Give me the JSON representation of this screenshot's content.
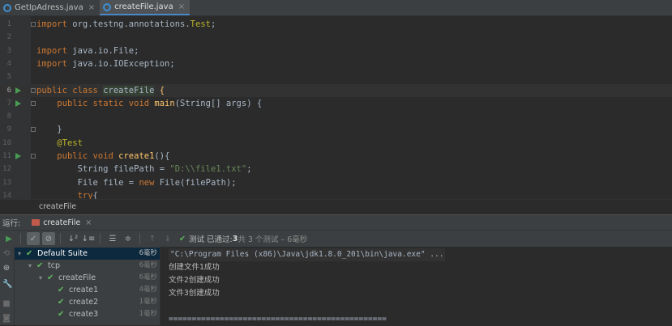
{
  "tabs": [
    {
      "label": "GetIpAdress.java",
      "active": false
    },
    {
      "label": "createFile.java",
      "active": true
    }
  ],
  "editor": {
    "lines": [
      {
        "no": "1",
        "tokens": [
          [
            "kw",
            "import "
          ],
          [
            "plain",
            "org.testng.annotations."
          ],
          [
            "ann",
            "Test"
          ],
          [
            "plain",
            ";"
          ]
        ]
      },
      {
        "no": "2",
        "tokens": []
      },
      {
        "no": "3",
        "tokens": [
          [
            "kw",
            "import "
          ],
          [
            "plain",
            "java.io.File;"
          ]
        ]
      },
      {
        "no": "4",
        "tokens": [
          [
            "kw",
            "import "
          ],
          [
            "plain",
            "java.io.IOException;"
          ]
        ]
      },
      {
        "no": "5",
        "tokens": []
      },
      {
        "no": "6",
        "tokens": [
          [
            "kw",
            "public class "
          ],
          [
            "hl",
            "createFile"
          ],
          [
            "plain",
            " "
          ],
          [
            "fn",
            "{"
          ]
        ]
      },
      {
        "no": "7",
        "tokens": [
          [
            "plain",
            "    "
          ],
          [
            "kw",
            "public static void "
          ],
          [
            "fn",
            "main"
          ],
          [
            "plain",
            "(String[] args) {"
          ]
        ]
      },
      {
        "no": "8",
        "tokens": []
      },
      {
        "no": "9",
        "tokens": [
          [
            "plain",
            "    }"
          ]
        ]
      },
      {
        "no": "10",
        "tokens": [
          [
            "plain",
            "    "
          ],
          [
            "ann",
            "@Test"
          ]
        ]
      },
      {
        "no": "11",
        "tokens": [
          [
            "plain",
            "    "
          ],
          [
            "kw",
            "public void "
          ],
          [
            "fn",
            "create1"
          ],
          [
            "plain",
            "(){"
          ]
        ]
      },
      {
        "no": "12",
        "tokens": [
          [
            "plain",
            "        String filePath = "
          ],
          [
            "str",
            "\"D:\\\\file1.txt\""
          ],
          [
            "plain",
            ";"
          ]
        ]
      },
      {
        "no": "13",
        "tokens": [
          [
            "plain",
            "        File file = "
          ],
          [
            "kw",
            "new "
          ],
          [
            "plain",
            "File(filePath);"
          ]
        ]
      },
      {
        "no": "14",
        "tokens": [
          [
            "plain",
            "        "
          ],
          [
            "kw",
            "try"
          ],
          [
            "plain",
            "{"
          ]
        ]
      }
    ]
  },
  "breadcrumb": "createFile",
  "run_window": {
    "label": "运行:",
    "tab": "createFile"
  },
  "run_status": {
    "prefix": "测试 已通过: ",
    "passed": "3",
    "suffix": "共 3 个测试 – 6毫秒"
  },
  "tree": [
    {
      "name": "Default Suite",
      "time": "6毫秒",
      "depth": 0,
      "selected": true
    },
    {
      "name": "tcp",
      "time": "6毫秒",
      "depth": 1,
      "selected": false
    },
    {
      "name": "createFile",
      "time": "6毫秒",
      "depth": 2,
      "selected": false
    },
    {
      "name": "create1",
      "time": "4毫秒",
      "depth": 3,
      "selected": false
    },
    {
      "name": "create2",
      "time": "1毫秒",
      "depth": 3,
      "selected": false
    },
    {
      "name": "create3",
      "time": "1毫秒",
      "depth": 3,
      "selected": false
    }
  ],
  "console": [
    "\"C:\\Program Files (x86)\\Java\\jdk1.8.0_201\\bin\\java.exe\" ...",
    "创建文件1成功",
    "文件2创建成功",
    "文件3创建成功",
    "",
    "==============================================="
  ],
  "colors": {
    "pass": "#5fb85f",
    "run_icon": "#499c54",
    "selection": "#0d293e",
    "keyword": "#cc7832",
    "string": "#6a8759",
    "annotation": "#bbb529",
    "function": "#ffc66d"
  }
}
